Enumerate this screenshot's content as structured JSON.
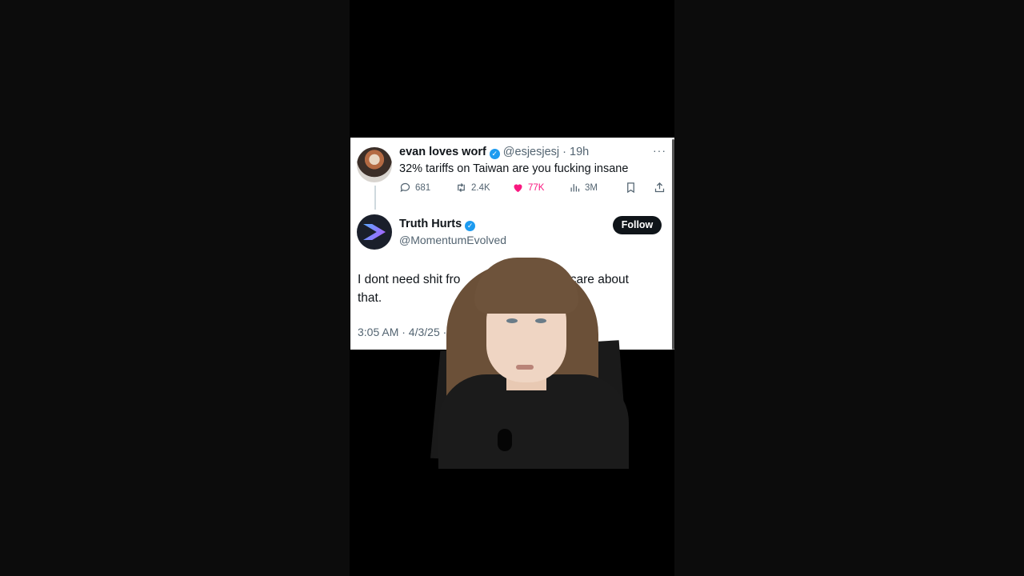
{
  "tweet1": {
    "name": "evan loves worf",
    "handle": "@esjesjesj",
    "separator": "·",
    "age": "19h",
    "text": "32% tariffs on Taiwan are you fucking insane",
    "more": "···",
    "replies": "681",
    "reposts": "2.4K",
    "likes": "77K",
    "views": "3M"
  },
  "tweet2": {
    "name": "Truth Hurts",
    "handle": "@MomentumEvolved",
    "follow_label": "Follow",
    "text_visible_1": "I dont need shit fro",
    "text_visible_2": "fuck I care about",
    "text_visible_3": "that.",
    "timestamp_visible": "3:05 AM · 4/3/25 · 6"
  },
  "colors": {
    "verified": "#1d9bf0",
    "like": "#f91880",
    "muted": "#536471",
    "follow_bg": "#0f1419"
  },
  "icons": [
    "reply-icon",
    "repost-icon",
    "like-icon",
    "views-icon",
    "bookmark-icon",
    "share-icon",
    "verified-icon",
    "more-icon"
  ]
}
